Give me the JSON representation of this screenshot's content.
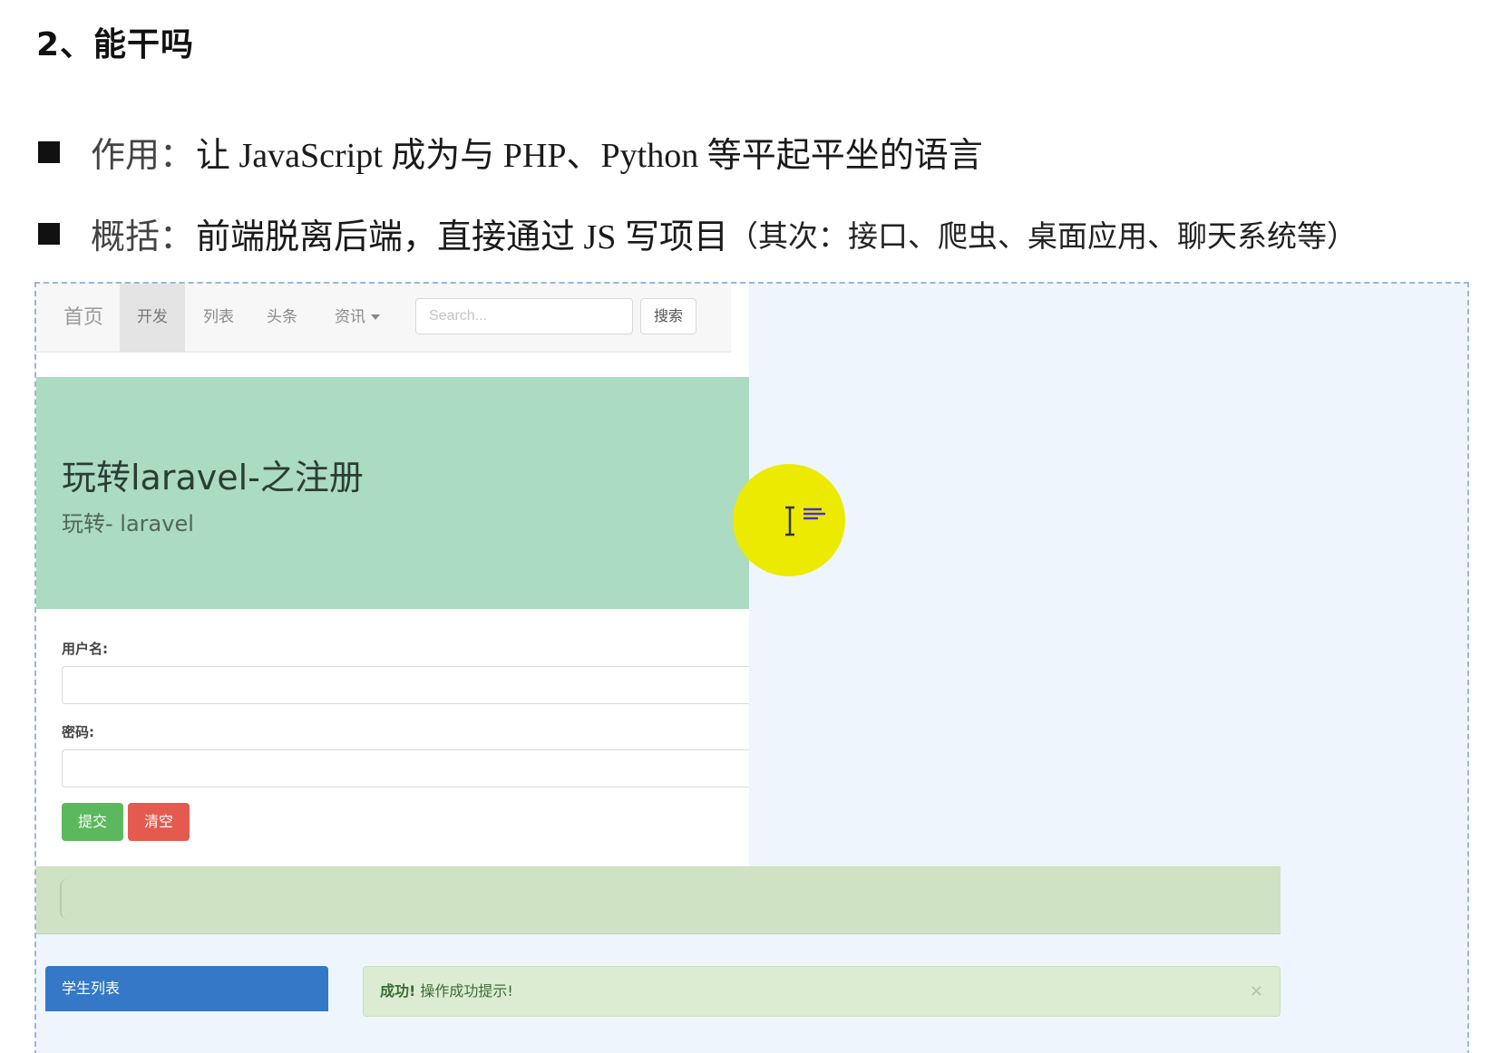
{
  "section": {
    "title": "2、能干吗"
  },
  "bullets": [
    {
      "label": "作用：",
      "text": "让 JavaScript 成为与 PHP、Python 等平起平坐的语言",
      "detail": ""
    },
    {
      "label": "概括：",
      "text": "前端脱离后端，直接通过 JS 写项目",
      "detail": "（其次：接口、爬虫、桌面应用、聊天系统等）"
    }
  ],
  "app": {
    "nav": {
      "home": "首页",
      "items": [
        "开发",
        "列表",
        "头条",
        "资讯"
      ],
      "search_placeholder": "Search...",
      "search_button": "搜索"
    },
    "hero": {
      "title": "玩转laravel-之注册",
      "subtitle": "玩转- laravel"
    },
    "form": {
      "username_label": "用户名:",
      "password_label": "密码:",
      "submit": "提交",
      "clear": "清空"
    },
    "student_list": {
      "title": "学生列表"
    },
    "alert": {
      "strong": "成功!",
      "message": " 操作成功提示!",
      "close": "×"
    }
  },
  "colors": {
    "hero_bg": "#abdbc1",
    "submit_bg": "#5cb85c",
    "clear_bg": "#e55a4e",
    "panel_header_bg": "#3478c7",
    "alert_bg": "#dbecd3",
    "cursor_highlight": "#ecea00"
  },
  "icons": {
    "cursor": "text-cursor-icon",
    "bullet": "square-bullet-icon"
  }
}
